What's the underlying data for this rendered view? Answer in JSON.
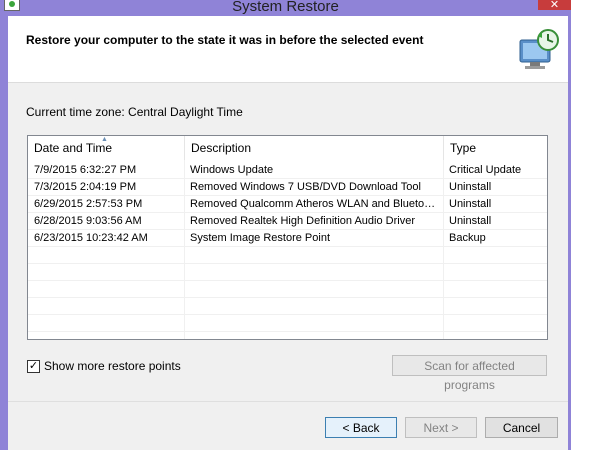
{
  "window": {
    "title": "System Restore",
    "close_glyph": "✕"
  },
  "header": {
    "text": "Restore your computer to the state it was in before the selected event",
    "icon": "system-restore-icon"
  },
  "timezone": "Current time zone: Central Daylight Time",
  "table": {
    "columns": [
      "Date and Time",
      "Description",
      "Type"
    ],
    "rows": [
      {
        "date": "7/9/2015 6:32:27 PM",
        "desc": "Windows Update",
        "type": "Critical Update"
      },
      {
        "date": "7/3/2015 2:04:19 PM",
        "desc": "Removed Windows 7 USB/DVD Download Tool",
        "type": "Uninstall"
      },
      {
        "date": "6/29/2015 2:57:53 PM",
        "desc": "Removed Qualcomm Atheros WLAN and Bluetoot...",
        "type": "Uninstall"
      },
      {
        "date": "6/28/2015 9:03:56 AM",
        "desc": "Removed Realtek High Definition Audio Driver",
        "type": "Uninstall"
      },
      {
        "date": "6/23/2015 10:23:42 AM",
        "desc": "System Image Restore Point",
        "type": "Backup"
      }
    ]
  },
  "show_more": {
    "label": "Show more restore points",
    "checked": true,
    "check_glyph": "✓"
  },
  "buttons": {
    "scan": "Scan for affected programs",
    "back": "< Back",
    "next": "Next >",
    "cancel": "Cancel"
  }
}
